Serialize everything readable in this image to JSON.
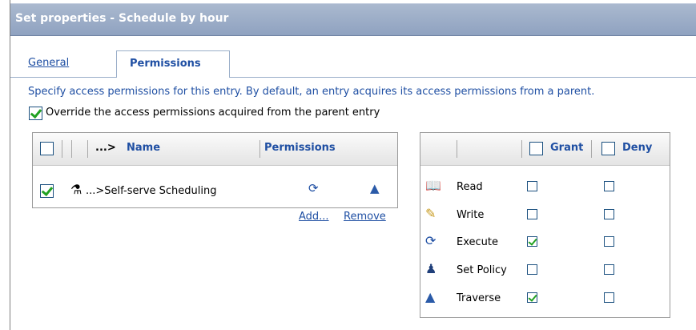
{
  "title": "Set properties - Schedule by hour",
  "tabs": {
    "general": "General",
    "permissions": "Permissions"
  },
  "description": "Specify access permissions for this entry. By default, an entry acquires its access permissions from a parent.",
  "override": {
    "label": "Override the access permissions acquired from the parent entry",
    "checked": true
  },
  "entries": {
    "header": {
      "name_prefix": "...>",
      "name": "Name",
      "permissions": "Permissions"
    },
    "rows": [
      {
        "name": "...>Self-serve Scheduling",
        "checked": true
      }
    ],
    "add": "Add...",
    "remove": "Remove"
  },
  "perm_table": {
    "grant": "Grant",
    "deny": "Deny",
    "rows": [
      {
        "label": "Read",
        "icon": "book-icon",
        "grant": false,
        "deny": false
      },
      {
        "label": "Write",
        "icon": "pencil-icon",
        "grant": false,
        "deny": false
      },
      {
        "label": "Execute",
        "icon": "cycle-arrows-icon",
        "grant": true,
        "deny": false
      },
      {
        "label": "Set Policy",
        "icon": "person-icon",
        "grant": false,
        "deny": false
      },
      {
        "label": "Traverse",
        "icon": "sailboat-icon",
        "grant": true,
        "deny": false
      }
    ]
  }
}
